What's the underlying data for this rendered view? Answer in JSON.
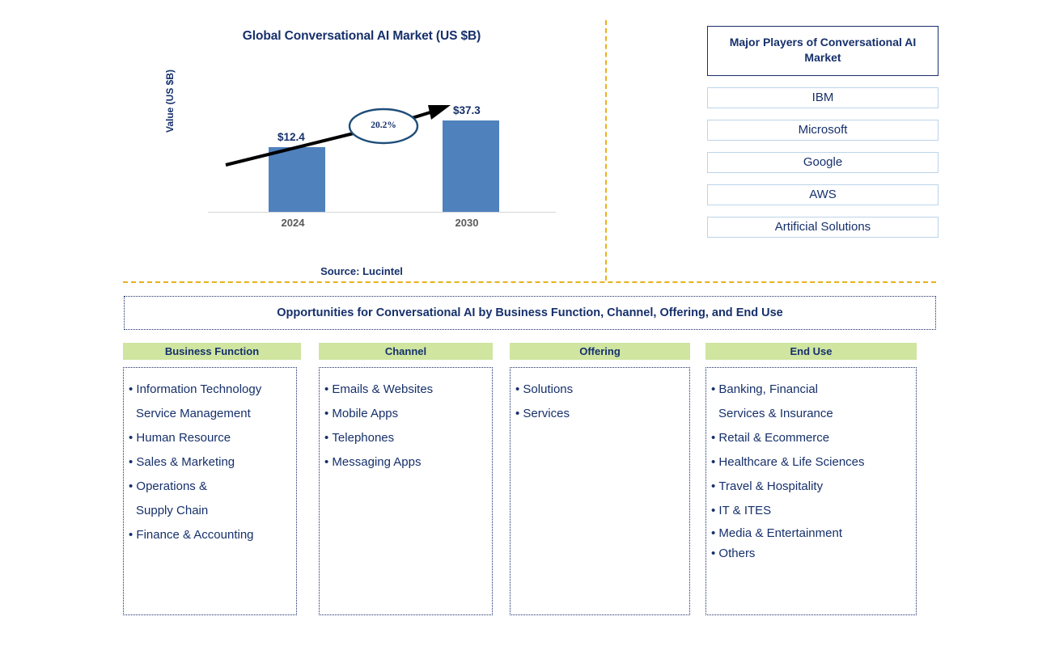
{
  "chart": {
    "title": "Global Conversational AI Market (US $B)",
    "y_axis_label": "Value (US $B)",
    "source": "Source: Lucintel",
    "cagr_label": "20.2%",
    "value_2024": "$12.4",
    "value_2030": "$37.3",
    "tick_2024": "2024",
    "tick_2030": "2030"
  },
  "chart_data": {
    "type": "bar",
    "title": "Global Conversational AI Market (US $B)",
    "categories": [
      "2024",
      "2030"
    ],
    "values": [
      12.4,
      37.3
    ],
    "data_labels": [
      "$12.4",
      "$37.3"
    ],
    "xlabel": "",
    "ylabel": "Value (US $B)",
    "ylim": [
      0,
      45
    ],
    "grid": false,
    "legend": "none",
    "annotations": [
      {
        "text": "20.2%",
        "type": "cagr-ellipse-with-arrow",
        "from": "2024",
        "to": "2030"
      }
    ],
    "series_color": "#4f81bd",
    "source": "Source: Lucintel"
  },
  "players": {
    "header": "Major Players of Conversational AI Market",
    "items": [
      "IBM",
      "Microsoft",
      "Google",
      "AWS",
      "Artificial Solutions"
    ]
  },
  "banner": {
    "title": "Opportunities for Conversational AI by Business Function, Channel, Offering, and End Use"
  },
  "columns": [
    {
      "header": "Business Function",
      "items": [
        {
          "text": "Information Technology",
          "cont": false
        },
        {
          "text": "Service Management",
          "cont": true
        },
        {
          "text": "Human Resource",
          "cont": false
        },
        {
          "text": "Sales & Marketing",
          "cont": false
        },
        {
          "text": "Operations &",
          "cont": false
        },
        {
          "text": "Supply Chain",
          "cont": true
        },
        {
          "text": "Finance & Accounting",
          "cont": false
        }
      ]
    },
    {
      "header": "Channel",
      "items": [
        {
          "text": "Emails & Websites",
          "cont": false
        },
        {
          "text": "Mobile Apps",
          "cont": false
        },
        {
          "text": "Telephones",
          "cont": false
        },
        {
          "text": "Messaging Apps",
          "cont": false
        }
      ]
    },
    {
      "header": "Offering",
      "items": [
        {
          "text": "Solutions",
          "cont": false
        },
        {
          "text": "Services",
          "cont": false
        }
      ]
    },
    {
      "header": "End Use",
      "items": [
        {
          "text": "Banking, Financial",
          "cont": false
        },
        {
          "text": "Services & Insurance",
          "cont": true
        },
        {
          "text": "Retail & Ecommerce",
          "cont": false
        },
        {
          "text": "Healthcare & Life Sciences",
          "cont": false
        },
        {
          "text": "Travel & Hospitality",
          "cont": false
        },
        {
          "text": "IT & ITES",
          "cont": false
        },
        {
          "text": "Media & Entertainment",
          "cont": false,
          "tight": true
        },
        {
          "text": "Others",
          "cont": false,
          "tight": true
        }
      ]
    }
  ],
  "colors": {
    "bar": "#4f81bd",
    "navy": "#16306b",
    "divider": "#e8b21a",
    "column_header": "#cfe5a0",
    "player_border": "#bcd4ea"
  }
}
